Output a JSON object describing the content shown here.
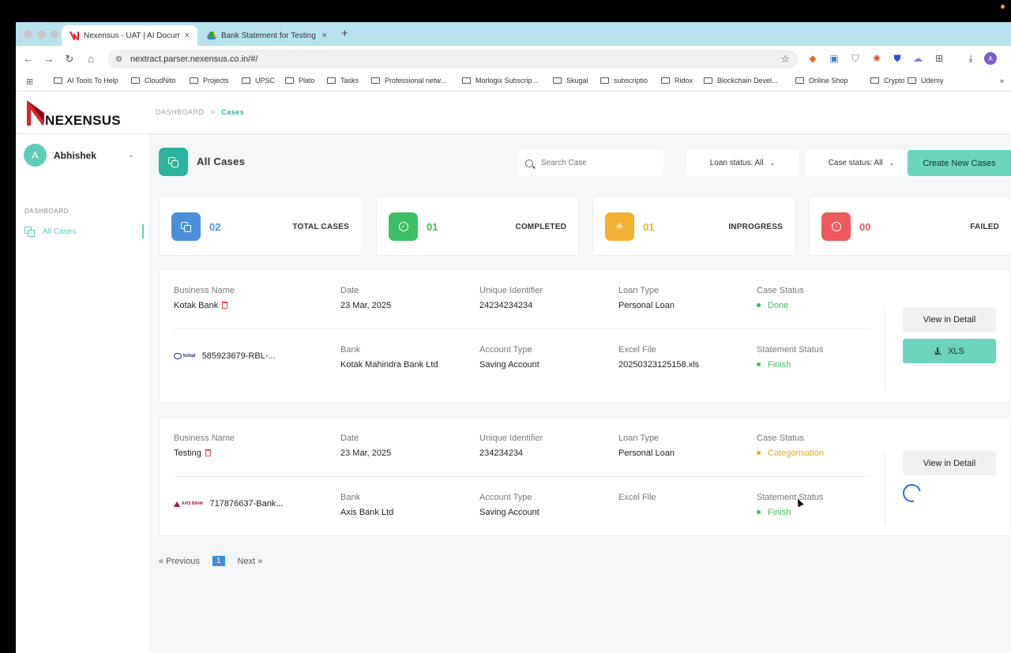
{
  "browser": {
    "tabs": [
      {
        "title": "Nexensus - UAT | AI Document",
        "close": "×"
      },
      {
        "title": "Bank Statement for Testing -",
        "close": "×"
      }
    ],
    "new_tab": "+",
    "url": "nextract.parser.nexensus.co.in/#/",
    "profile_initial": "A",
    "bookmarks": [
      "AI Tools To Help",
      "CloudNito",
      "Projects",
      "UPSC",
      "Plato",
      "Tasks",
      "Professional netw...",
      "Morlogix Subscrip...",
      "Skugal",
      "subscriptio",
      "Ridox",
      "Blockchain Devel...",
      "Online Shop",
      "Crypto",
      "Udemy"
    ]
  },
  "app": {
    "logo_text": "NEXENSUS",
    "breadcrumb": {
      "root": "DASHBOARD",
      "separator": ">",
      "current": "Cases"
    },
    "sidebar": {
      "user_initial": "A",
      "user_name": "Abhishek",
      "section": "DASHBOARD",
      "items": [
        {
          "label": "All Cases"
        }
      ]
    },
    "page_title": "All Cases",
    "search_placeholder": "Search Case",
    "loan_status_filter": "Loan status: All",
    "case_status_filter": "Case status: All",
    "create_button": "Create New Cases",
    "stats": [
      {
        "value": "02",
        "label": "TOTAL CASES",
        "color": "#4a8fd8"
      },
      {
        "value": "01",
        "label": "COMPLETED",
        "color": "#3cbf62"
      },
      {
        "value": "01",
        "label": "INPROGRESS",
        "color": "#f0b030"
      },
      {
        "value": "00",
        "label": "FAILED",
        "color": "#ee5a5a"
      }
    ],
    "labels": {
      "business_name": "Business Name",
      "date": "Date",
      "unique_identifier": "Unique Identifier",
      "loan_type": "Loan Type",
      "case_status": "Case Status",
      "bank": "Bank",
      "account_type": "Account Type",
      "excel_file": "Excel File",
      "statement_status": "Statement Status"
    },
    "cases": [
      {
        "business_name": "Kotak Bank",
        "date": "23 Mar, 2025",
        "unique_identifier": "24234234234",
        "loan_type": "Personal Loan",
        "case_status": "Done",
        "bank_logo": "kotak",
        "statement_name": "585923679-RBL-...",
        "bank": "Kotak Mahindra Bank Ltd",
        "account_type": "Saving Account",
        "excel_file": "20250323125158.xls",
        "statement_status": "Finish",
        "view_button": "View in Detail",
        "xls_button": "XLS"
      },
      {
        "business_name": "Testing",
        "date": "23 Mar, 2025",
        "unique_identifier": "234234234",
        "loan_type": "Personal Loan",
        "case_status": "Categorisation",
        "bank_logo": "AXIS BANK",
        "statement_name": "717876637-Bank...",
        "bank": "Axis Bank Ltd",
        "account_type": "Saving Account",
        "excel_file": "",
        "statement_status": "Finish",
        "view_button": "View in Detail"
      }
    ],
    "pagination": {
      "prev": "« Previous",
      "page": "1",
      "next": "Next »"
    }
  }
}
